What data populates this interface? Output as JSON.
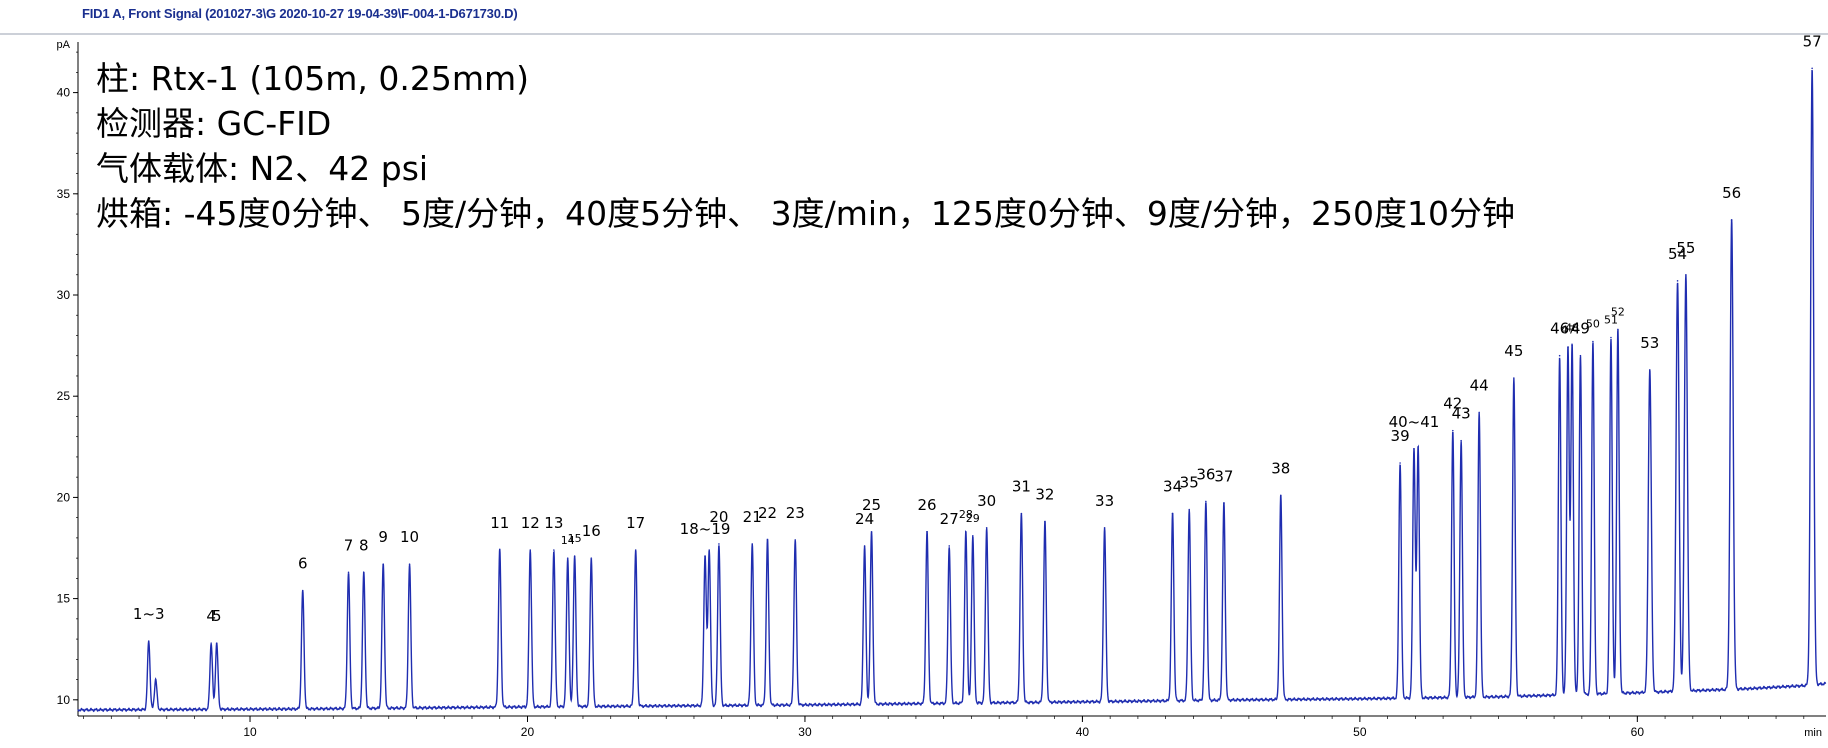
{
  "window": {
    "title": "FID1 A, Front Signal (201027-3\\G 2020-10-27 19-04-39\\F-004-1-D671730.D)"
  },
  "info_text": {
    "column": "柱: Rtx-1 (105m, 0.25mm)",
    "detector": "检测器: GC-FID",
    "carrier_gas": "气体载体: N2、42  psi",
    "oven": "烘箱: -45度0分钟、  5度/分钟，40度5分钟、  3度/min，125度0分钟、9度/分钟，250度10分钟"
  },
  "colors": {
    "trace": "#1f2db0",
    "axis": "#000000",
    "header_text": "#1a2f8f"
  },
  "chart_data": {
    "type": "line",
    "title": "",
    "xlabel": "min",
    "ylabel": "pA",
    "xlim": [
      3.8,
      66.8
    ],
    "ylim": [
      9.2,
      42.5
    ],
    "x_ticks": [
      "10",
      "20",
      "30",
      "40",
      "50",
      "60"
    ],
    "y_ticks": [
      "10",
      "15",
      "20",
      "25",
      "30",
      "35",
      "40"
    ],
    "grid": false,
    "baseline": [
      [
        3.8,
        9.5
      ],
      [
        12.0,
        9.55
      ],
      [
        20.0,
        9.65
      ],
      [
        30.0,
        9.75
      ],
      [
        40.0,
        9.9
      ],
      [
        46.0,
        10.0
      ],
      [
        50.0,
        10.05
      ],
      [
        55.0,
        10.15
      ],
      [
        60.0,
        10.35
      ],
      [
        64.0,
        10.55
      ],
      [
        66.0,
        10.7
      ],
      [
        66.8,
        10.8
      ]
    ],
    "peaks": [
      {
        "x": 6.35,
        "y": 12.9,
        "label": "1~3"
      },
      {
        "x": 6.6,
        "y": 11.0,
        "label": ""
      },
      {
        "x": 8.6,
        "y": 12.8,
        "label": "4"
      },
      {
        "x": 8.8,
        "y": 12.8,
        "label": "5"
      },
      {
        "x": 11.9,
        "y": 15.4,
        "label": "6"
      },
      {
        "x": 13.55,
        "y": 16.3,
        "label": "7"
      },
      {
        "x": 14.1,
        "y": 16.3,
        "label": "8"
      },
      {
        "x": 14.8,
        "y": 16.7,
        "label": "9"
      },
      {
        "x": 15.75,
        "y": 16.7,
        "label": "10"
      },
      {
        "x": 19.0,
        "y": 17.4,
        "label": "11"
      },
      {
        "x": 20.1,
        "y": 17.4,
        "label": "12"
      },
      {
        "x": 20.95,
        "y": 17.4,
        "label": "13"
      },
      {
        "x": 21.45,
        "y": 17.0,
        "label": "14"
      },
      {
        "x": 21.7,
        "y": 17.1,
        "label": "15"
      },
      {
        "x": 22.3,
        "y": 17.0,
        "label": "16"
      },
      {
        "x": 23.9,
        "y": 17.4,
        "label": "17"
      },
      {
        "x": 26.4,
        "y": 17.1,
        "label": "18~19"
      },
      {
        "x": 26.55,
        "y": 17.4,
        "label": ""
      },
      {
        "x": 26.9,
        "y": 17.7,
        "label": "20"
      },
      {
        "x": 28.1,
        "y": 17.7,
        "label": "21"
      },
      {
        "x": 28.65,
        "y": 17.9,
        "label": "22"
      },
      {
        "x": 29.65,
        "y": 17.9,
        "label": "23"
      },
      {
        "x": 32.15,
        "y": 17.6,
        "label": "24"
      },
      {
        "x": 32.4,
        "y": 18.3,
        "label": "25"
      },
      {
        "x": 34.4,
        "y": 18.3,
        "label": "26"
      },
      {
        "x": 35.2,
        "y": 17.6,
        "label": "27"
      },
      {
        "x": 35.8,
        "y": 18.3,
        "label": "28"
      },
      {
        "x": 36.05,
        "y": 18.1,
        "label": "29"
      },
      {
        "x": 36.55,
        "y": 18.5,
        "label": "30"
      },
      {
        "x": 37.8,
        "y": 19.2,
        "label": "31"
      },
      {
        "x": 38.65,
        "y": 18.8,
        "label": "32"
      },
      {
        "x": 40.8,
        "y": 18.5,
        "label": "33"
      },
      {
        "x": 43.25,
        "y": 19.2,
        "label": "34"
      },
      {
        "x": 43.85,
        "y": 19.4,
        "label": "35"
      },
      {
        "x": 44.45,
        "y": 19.8,
        "label": "36"
      },
      {
        "x": 45.1,
        "y": 19.7,
        "label": "37"
      },
      {
        "x": 47.15,
        "y": 20.1,
        "label": "38"
      },
      {
        "x": 51.45,
        "y": 21.7,
        "label": "39"
      },
      {
        "x": 51.95,
        "y": 22.4,
        "label": "40~41"
      },
      {
        "x": 52.1,
        "y": 22.5,
        "label": ""
      },
      {
        "x": 53.35,
        "y": 23.3,
        "label": "42"
      },
      {
        "x": 53.65,
        "y": 22.8,
        "label": "43"
      },
      {
        "x": 54.3,
        "y": 24.2,
        "label": "44"
      },
      {
        "x": 55.55,
        "y": 25.9,
        "label": "45"
      },
      {
        "x": 57.2,
        "y": 27.0,
        "label": "46"
      },
      {
        "x": 57.5,
        "y": 27.4,
        "label": "47"
      },
      {
        "x": 57.65,
        "y": 27.5,
        "label": "48"
      },
      {
        "x": 57.95,
        "y": 27.0,
        "label": "49"
      },
      {
        "x": 58.4,
        "y": 27.7,
        "label": "50"
      },
      {
        "x": 59.05,
        "y": 27.9,
        "label": "51"
      },
      {
        "x": 59.3,
        "y": 28.3,
        "label": "52"
      },
      {
        "x": 60.45,
        "y": 26.3,
        "label": "53"
      },
      {
        "x": 61.45,
        "y": 30.7,
        "label": "54"
      },
      {
        "x": 61.75,
        "y": 31.0,
        "label": "55"
      },
      {
        "x": 63.4,
        "y": 33.7,
        "label": "56"
      },
      {
        "x": 66.3,
        "y": 41.2,
        "label": "57"
      }
    ]
  }
}
